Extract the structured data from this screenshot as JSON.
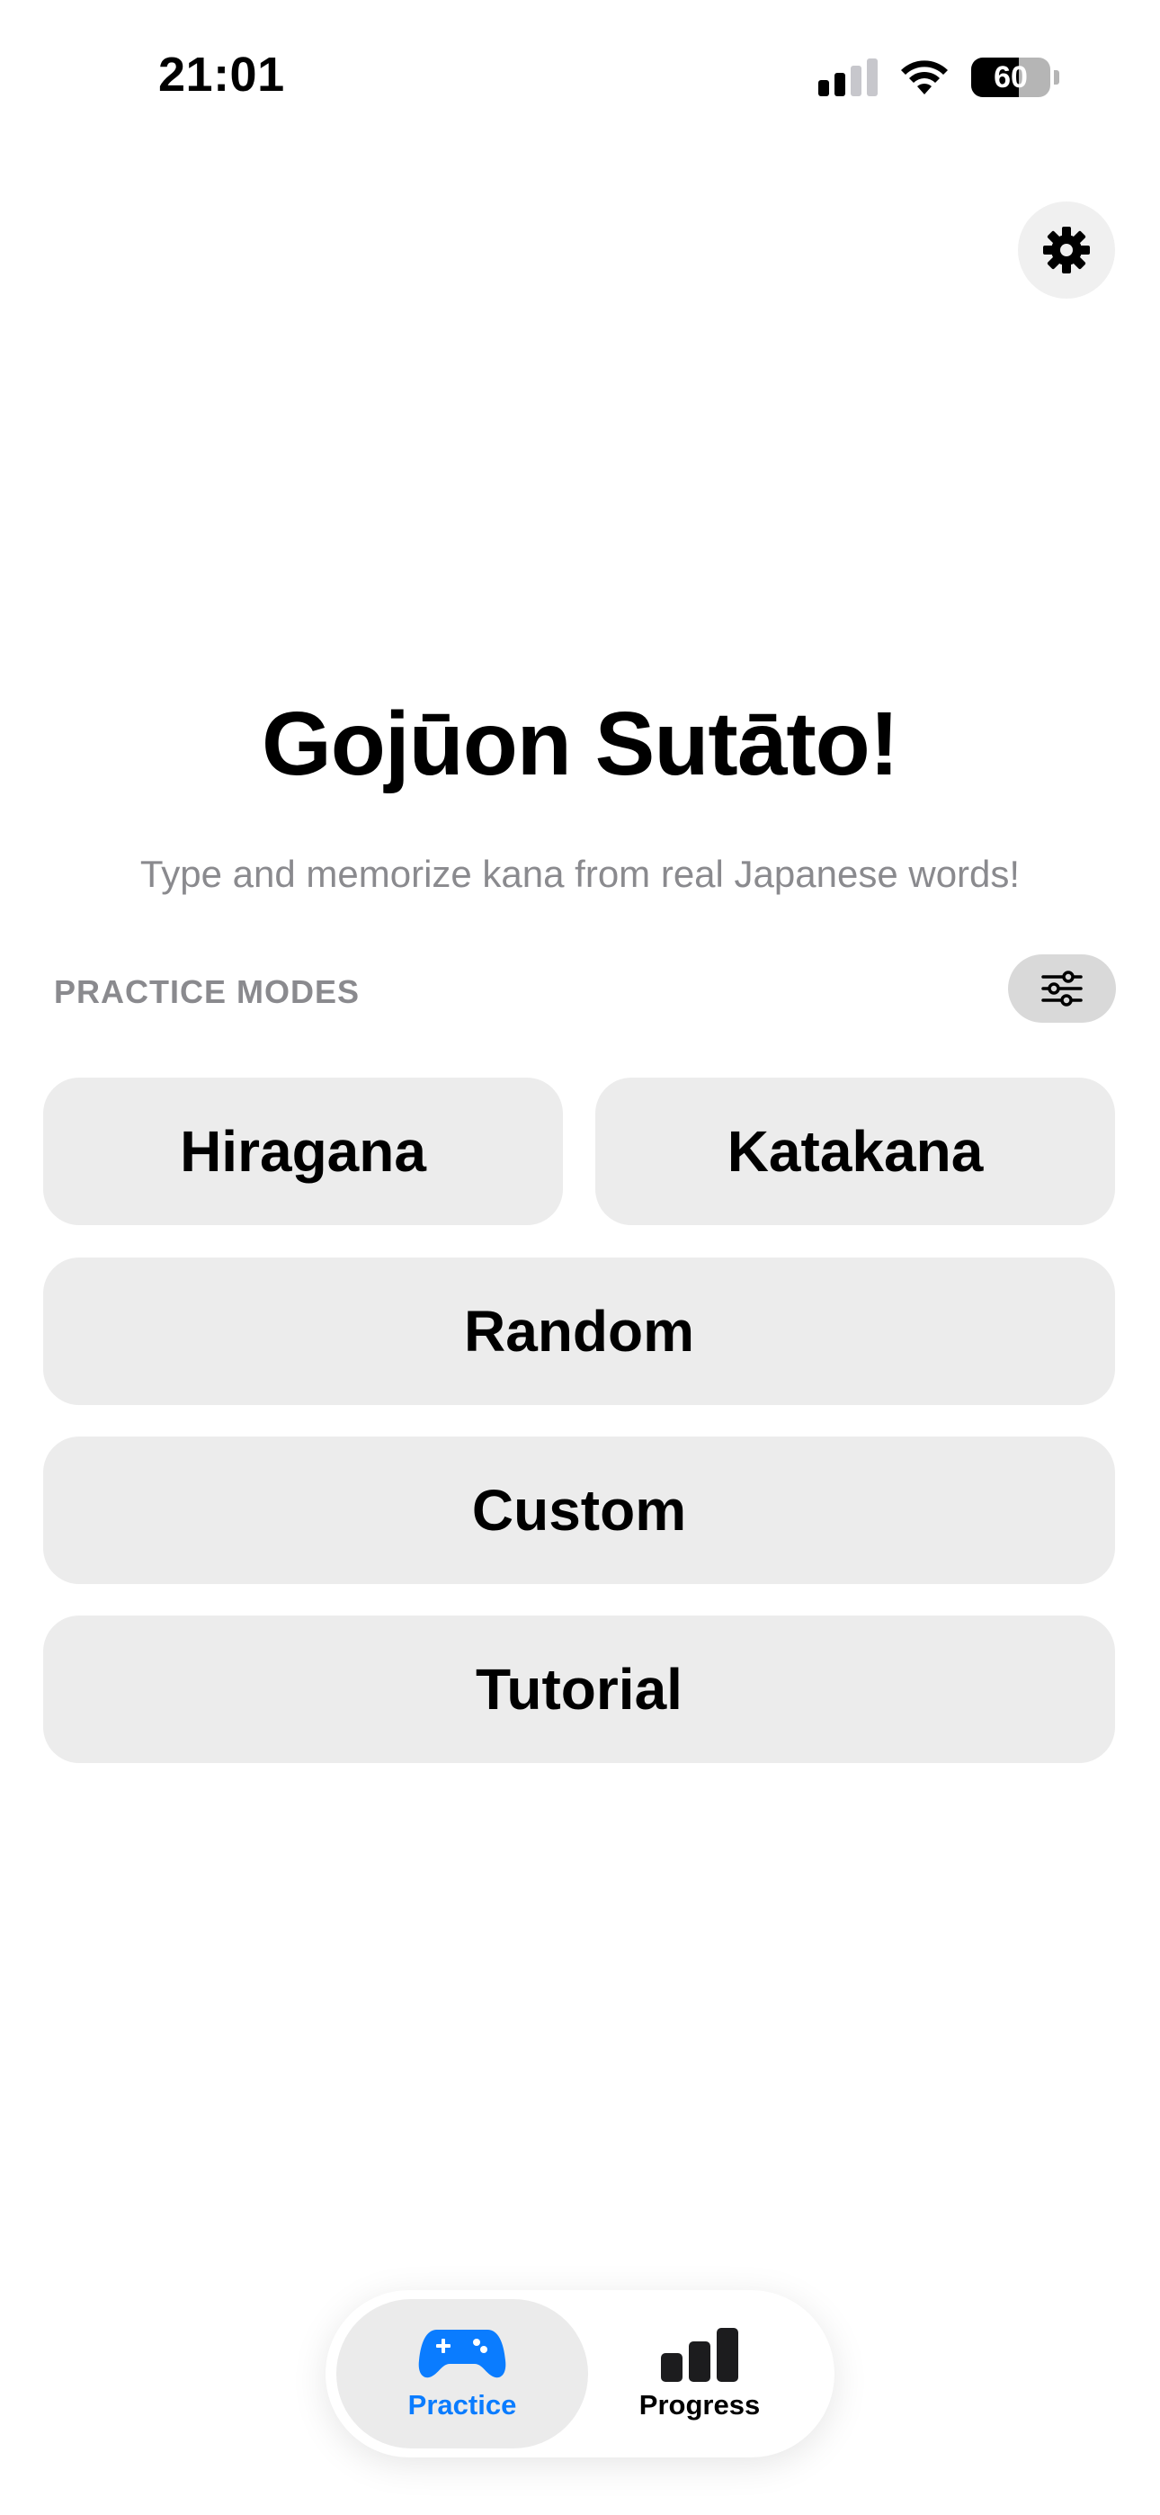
{
  "status_bar": {
    "time": "21:01",
    "battery": "60"
  },
  "app": {
    "title": "Gojūon Sutāto!",
    "subtitle": "Type and memorize kana from real Japanese words!"
  },
  "practice": {
    "section_label": "PRACTICE MODES",
    "modes": {
      "hiragana": "Hiragana",
      "katakana": "Katakana",
      "random": "Random",
      "custom": "Custom",
      "tutorial": "Tutorial"
    }
  },
  "tabbar": {
    "tabs": [
      {
        "label": "Practice",
        "icon": "gamecontroller-icon",
        "active": true
      },
      {
        "label": "Progress",
        "icon": "bar-chart-icon",
        "active": false
      }
    ]
  },
  "colors": {
    "accent": "#0a7cff",
    "button_bg": "#ececec",
    "secondary_text": "#8a8a8e"
  }
}
